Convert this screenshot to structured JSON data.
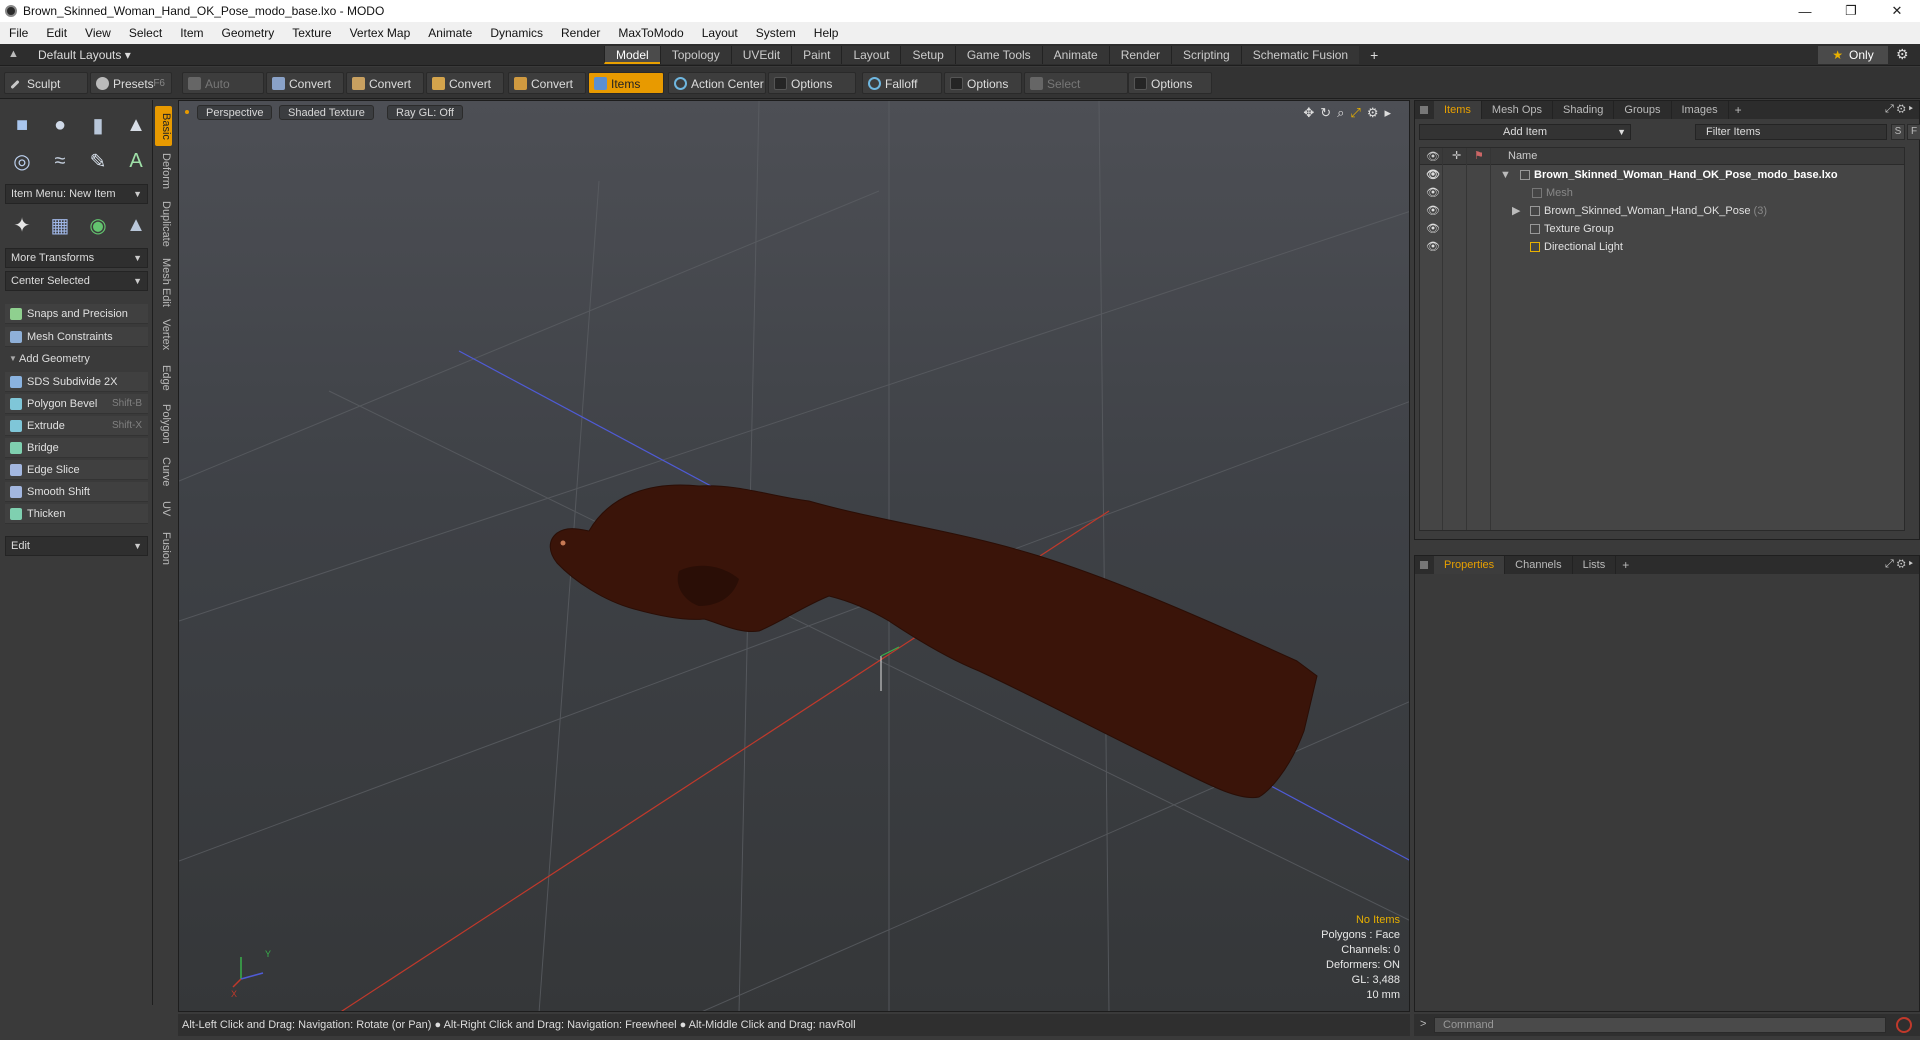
{
  "window": {
    "title": "Brown_Skinned_Woman_Hand_OK_Pose_modo_base.lxo - MODO",
    "minimize": "—",
    "restore": "❐",
    "close": "✕"
  },
  "menu": [
    "File",
    "Edit",
    "View",
    "Select",
    "Item",
    "Geometry",
    "Texture",
    "Vertex Map",
    "Animate",
    "Dynamics",
    "Render",
    "MaxToModo",
    "Layout",
    "System",
    "Help"
  ],
  "layoutbar": {
    "layout_select": "Default Layouts ▾",
    "tabs": [
      "Model",
      "Topology",
      "UVEdit",
      "Paint",
      "Layout",
      "Setup",
      "Game Tools",
      "Animate",
      "Render",
      "Scripting",
      "Schematic Fusion"
    ],
    "active_tab": "Model",
    "plus": "+",
    "only": "Only",
    "gear": "⚙"
  },
  "toolbar": {
    "sculpt": "Sculpt",
    "presets": "Presets",
    "presets_key": "F6",
    "auto_select": "Auto Select",
    "convert1": "Convert",
    "convert2": "Convert",
    "convert3": "Convert",
    "convert4": "Convert",
    "items": "Items",
    "action_center": "Action Center",
    "options1": "Options",
    "falloff": "Falloff",
    "options2": "Options",
    "select_through": "Select Through",
    "options3": "Options"
  },
  "leftpanel": {
    "item_menu": "Item Menu: New Item",
    "more_transforms": "More Transforms",
    "center_selected": "Center Selected",
    "snaps": "Snaps and Precision",
    "mesh_constraints": "Mesh Constraints",
    "add_geometry": "Add Geometry",
    "tools": [
      {
        "label": "SDS Subdivide 2X",
        "shortcut": ""
      },
      {
        "label": "Polygon Bevel",
        "shortcut": "Shift-B"
      },
      {
        "label": "Extrude",
        "shortcut": "Shift-X"
      },
      {
        "label": "Bridge",
        "shortcut": ""
      },
      {
        "label": "Edge Slice",
        "shortcut": ""
      },
      {
        "label": "Smooth Shift",
        "shortcut": ""
      },
      {
        "label": "Thicken",
        "shortcut": ""
      }
    ],
    "edit": "Edit"
  },
  "vtabs": [
    "Basic",
    "Deform",
    "Duplicate",
    "Mesh Edit",
    "Vertex",
    "Edge",
    "Polygon",
    "Curve",
    "UV",
    "Fusion"
  ],
  "viewport": {
    "view": "Perspective",
    "shading": "Shaded Texture",
    "raygl": "Ray GL: Off",
    "info": {
      "no_items": "No Items",
      "polygons": "Polygons : Face",
      "channels": "Channels: 0",
      "deformers": "Deformers: ON",
      "gl": "GL: 3,488",
      "scale": "10 mm"
    },
    "axis_y": "Y",
    "axis_x": "X"
  },
  "statusbar": "Alt-Left Click and Drag: Navigation: Rotate (or Pan) ● Alt-Right Click and Drag: Navigation: Freewheel ● Alt-Middle Click and Drag: navRoll",
  "itemspanel": {
    "tabs": [
      "Items",
      "Mesh Ops",
      "Shading",
      "Groups",
      "Images"
    ],
    "plus": "+",
    "add_item": "Add Item",
    "filter": "Filter Items",
    "s_btn": "S",
    "f_btn": "F",
    "name_header": "Name",
    "tree": [
      {
        "label": "Brown_Skinned_Woman_Hand_OK_Pose_modo_base.lxo",
        "count": ""
      },
      {
        "label": "Mesh",
        "count": ""
      },
      {
        "label": "Brown_Skinned_Woman_Hand_OK_Pose",
        "count": "(3)"
      },
      {
        "label": "Texture Group",
        "count": ""
      },
      {
        "label": "Directional Light",
        "count": ""
      }
    ]
  },
  "proppanel": {
    "tabs": [
      "Properties",
      "Channels",
      "Lists"
    ],
    "plus": "+"
  },
  "command": {
    "placeholder": "Command",
    "arrow": ">"
  },
  "colors": {
    "accent": "#e89a00",
    "skin": "#3a1409",
    "grid": "#5a5d62"
  }
}
